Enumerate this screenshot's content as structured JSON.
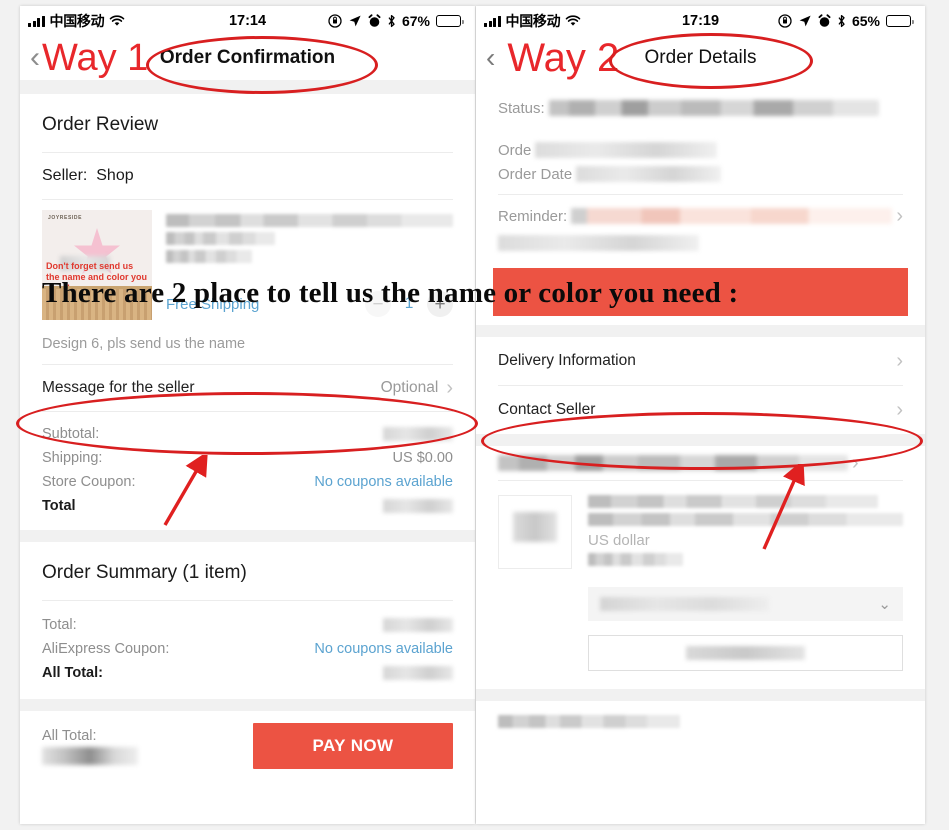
{
  "annotation": {
    "overlay_text": "There are 2 place to tell us the name or color you need :",
    "way1_label": "Way 1",
    "way2_label": "Way 2",
    "highlight_color": "#d81f20",
    "band_color": "#ec5343"
  },
  "left_phone": {
    "status_bar": {
      "carrier": "中国移动",
      "time": "17:14",
      "battery_percent": "67%",
      "icons": [
        "signal-bars-icon",
        "wifi-icon",
        "rotation-lock-icon",
        "location-arrow-icon",
        "alarm-clock-icon",
        "bluetooth-icon",
        "battery-icon"
      ]
    },
    "nav": {
      "back_icon": "chevron-left-icon",
      "title": "Order Confirmation"
    },
    "order_review": {
      "heading": "Order Review",
      "seller_label": "Seller:",
      "seller_name": "Shop",
      "product": {
        "thumb_brand": "JOYRESIDE",
        "thumb_caption": "Don't forget send us the name and color you need!",
        "shipping_label": "Free Shipping",
        "quantity": "1",
        "minus_icon": "minus-icon",
        "plus_icon": "plus-icon"
      },
      "design_note": "Design 6, pls send us the name",
      "message_row": {
        "label": "Message for the seller",
        "value": "Optional",
        "chevron": "chevron-right-icon"
      },
      "totals": [
        {
          "label": "Subtotal:",
          "value": "",
          "type": "blurred"
        },
        {
          "label": "Shipping:",
          "value": "US $0.00",
          "type": "text"
        },
        {
          "label": "Store Coupon:",
          "value": "No coupons available",
          "type": "link"
        },
        {
          "label": "Total",
          "value": "",
          "type": "blurred",
          "bold": true
        }
      ]
    },
    "order_summary": {
      "heading": "Order Summary (1 item)",
      "rows": [
        {
          "label": "Total:",
          "value": "",
          "type": "blurred"
        },
        {
          "label": "AliExpress Coupon:",
          "value": "No coupons available",
          "type": "link"
        },
        {
          "label": "All Total:",
          "value": "",
          "type": "blurred",
          "bold": true
        }
      ]
    },
    "pay_bar": {
      "total_label": "All Total:",
      "amount": "",
      "button_label": "PAY NOW"
    }
  },
  "right_phone": {
    "status_bar": {
      "carrier": "中国移动",
      "time": "17:19",
      "battery_percent": "65%",
      "icons": [
        "signal-bars-icon",
        "wifi-icon",
        "rotation-lock-icon",
        "location-arrow-icon",
        "alarm-clock-icon",
        "bluetooth-icon",
        "battery-icon"
      ]
    },
    "nav": {
      "back_icon": "chevron-left-icon",
      "title": "Order Details"
    },
    "details": [
      {
        "label": "Status:",
        "value": "",
        "type": "blurred"
      },
      {
        "label": "Orde",
        "value": "",
        "type": "blurred"
      },
      {
        "label": "Order Date",
        "value": "",
        "type": "blurred"
      },
      {
        "label": "Reminder:",
        "value": "",
        "type": "blurred-pink"
      }
    ],
    "actions": [
      {
        "label": "Delivery Information",
        "chevron": "chevron-right-icon"
      },
      {
        "label": "Contact Seller",
        "chevron": "chevron-right-icon"
      }
    ],
    "order_item": {
      "currency_note": "US dollar",
      "select_chevron": "chevron-down-icon"
    }
  }
}
